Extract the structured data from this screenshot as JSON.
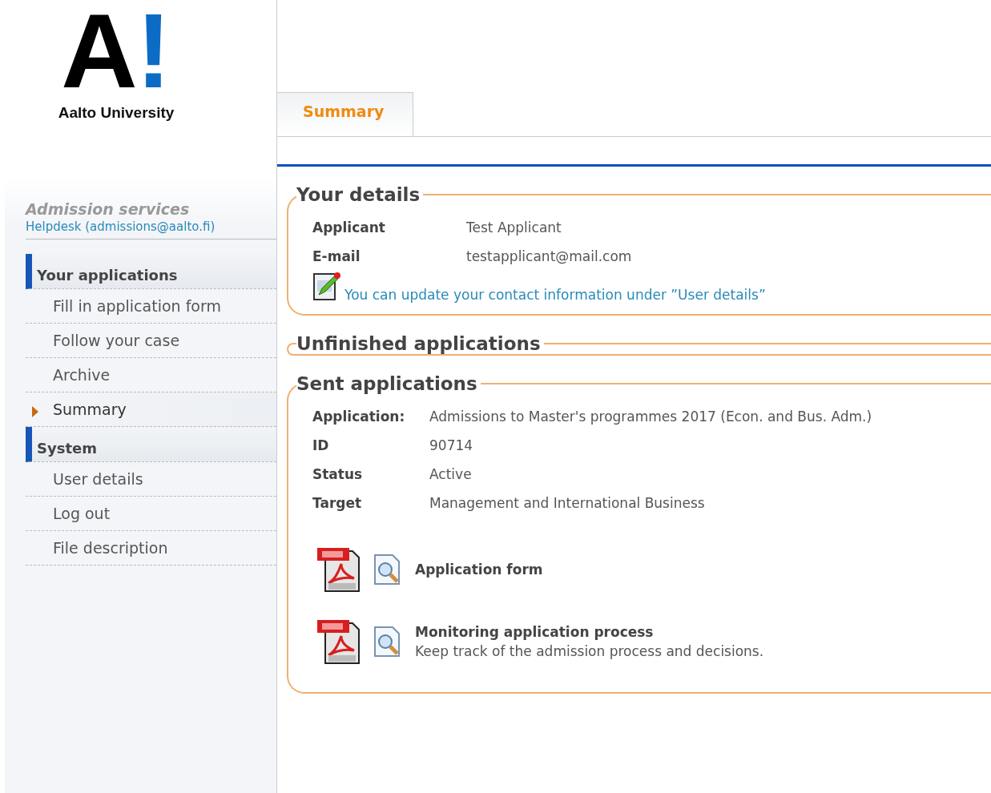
{
  "logo": {
    "mark": "A",
    "accent": "!",
    "name": "Aalto University"
  },
  "sidebar": {
    "title": "Admission services",
    "helpdesk": "Helpdesk (admissions@aalto.fi)",
    "items": [
      {
        "kind": "header",
        "label": "Your applications"
      },
      {
        "kind": "link",
        "label": "Fill in application form",
        "selected": false
      },
      {
        "kind": "link",
        "label": "Follow your case",
        "selected": false
      },
      {
        "kind": "link",
        "label": "Archive",
        "selected": false
      },
      {
        "kind": "link",
        "label": "Summary",
        "selected": true
      },
      {
        "kind": "header",
        "label": "System"
      },
      {
        "kind": "link",
        "label": "User details",
        "selected": false
      },
      {
        "kind": "link",
        "label": "Log out",
        "selected": false
      },
      {
        "kind": "link",
        "label": "File description",
        "selected": false
      }
    ]
  },
  "tabs": [
    {
      "label": "Summary",
      "selected": true
    }
  ],
  "your_details": {
    "title": "Your details",
    "fields": [
      {
        "label": "Applicant",
        "value": "Test Applicant"
      },
      {
        "label": "E-mail",
        "value": "testapplicant@mail.com"
      }
    ],
    "note": "You can update your contact information under ”User details”"
  },
  "unfinished_applications": {
    "title": "Unfinished applications"
  },
  "sent_applications": {
    "title": "Sent applications",
    "fields": [
      {
        "label": "Application:",
        "value": "Admissions to Master's programmes 2017 (Econ. and Bus. Adm.)"
      },
      {
        "label": "ID",
        "value": "90714"
      },
      {
        "label": "Status",
        "value": "Active"
      },
      {
        "label": "Target",
        "value": "Management and International Business"
      }
    ],
    "documents": [
      {
        "title": "Application form"
      },
      {
        "title": "Monitoring application process",
        "description": "Keep track of the admission process and decisions."
      }
    ]
  }
}
